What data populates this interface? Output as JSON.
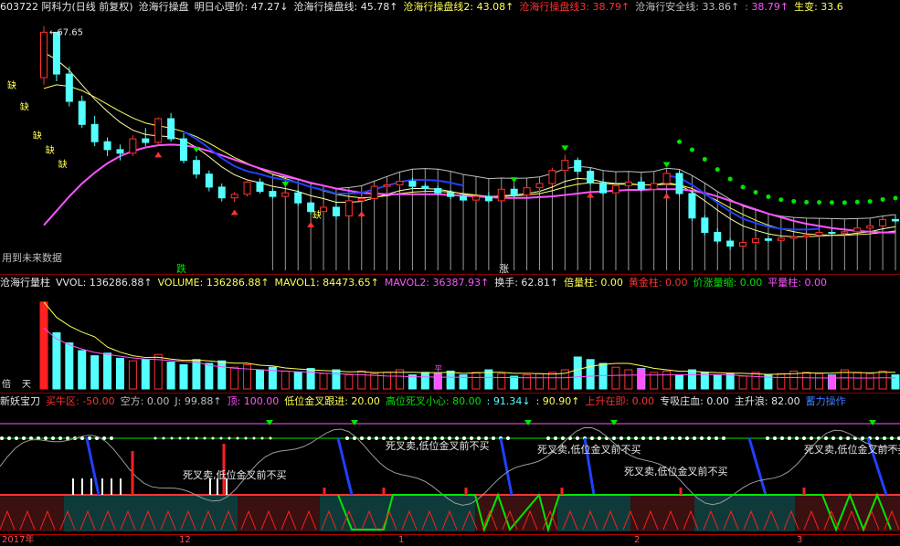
{
  "main_header": [
    {
      "text": "603722 阿科力(日线 前复权)",
      "color": "white"
    },
    {
      "text": "沧海行操盘",
      "color": "white"
    },
    {
      "text": "明日心理价: 47.27↓",
      "color": "white"
    },
    {
      "text": "沧海行操盘线: 45.78↑",
      "color": "white"
    },
    {
      "text": "沧海行操盘线2: 43.08↑",
      "color": "yellow"
    },
    {
      "text": "沧海行操盘线3: 38.79↑",
      "color": "red"
    },
    {
      "text": "沧海行安全线: 33.86↑",
      "color": "gray"
    },
    {
      "text": ": 38.79↑",
      "color": "magenta"
    },
    {
      "text": "生变: 33.6",
      "color": "yellow"
    }
  ],
  "price_high_label": "67.65",
  "watermark": "用到未来数据",
  "signal_die": "跌",
  "signal_zhang": "涨",
  "missing_tag": "缺",
  "volume_header": [
    {
      "text": "沧海行量柱",
      "color": "white"
    },
    {
      "text": "VVOL: 136286.88↑",
      "color": "white"
    },
    {
      "text": "VOLUME: 136286.88↑",
      "color": "yellow"
    },
    {
      "text": "MAVOL1: 84473.65↑",
      "color": "yellow"
    },
    {
      "text": "MAVOL2: 36387.93↑",
      "color": "magenta"
    },
    {
      "text": "换手: 62.81↑",
      "color": "white"
    },
    {
      "text": "倍量柱: 0.00",
      "color": "yellow"
    },
    {
      "text": "黄金柱: 0.00",
      "color": "red"
    },
    {
      "text": "价涨量缩: 0.00",
      "color": "green"
    },
    {
      "text": "平量柱: 0.00",
      "color": "magenta"
    }
  ],
  "volume_side_labels": [
    "倍",
    "天"
  ],
  "volume_mark": "平",
  "ind_header": [
    {
      "text": "新妖宝刀",
      "color": "white"
    },
    {
      "text": "买牛区: -50.00",
      "color": "red"
    },
    {
      "text": "空方: 0.00",
      "color": "gray"
    },
    {
      "text": "J: 99.88↑",
      "color": "gray"
    },
    {
      "text": "顶: 100.00",
      "color": "magenta"
    },
    {
      "text": "低位金叉跟进: 20.00",
      "color": "yellow"
    },
    {
      "text": "高位死叉小心: 80.00",
      "color": "green"
    },
    {
      "text": ": 91.34↓",
      "color": "cyan"
    },
    {
      "text": ": 90.90↑",
      "color": "yellow"
    },
    {
      "text": "上升在即: 0.00",
      "color": "red"
    },
    {
      "text": "专吸庄血: 0.00",
      "color": "white"
    },
    {
      "text": "主升浪: 82.00",
      "color": "white"
    },
    {
      "text": "蓄力操作",
      "color": "blue"
    }
  ],
  "annotation_text": "死叉卖,低位金叉前不买",
  "time_axis": [
    "2017年",
    "12",
    "1",
    "2",
    "3"
  ],
  "chart_data": {
    "type": "candlestick",
    "title": "603722 阿科力(日线 前复权)",
    "x_ticks": [
      "2017年",
      "12",
      "1",
      "2",
      "3"
    ],
    "price_extremes": {
      "high": 67.65
    },
    "candles": [
      [
        60.5,
        67.65,
        59.5,
        66.8
      ],
      [
        66.8,
        66.2,
        60.0,
        61.0
      ],
      [
        61.0,
        62.0,
        56.5,
        57.2
      ],
      [
        57.2,
        58.0,
        53.5,
        54.0
      ],
      [
        54.0,
        55.2,
        51.0,
        51.6
      ],
      [
        51.6,
        52.2,
        49.6,
        50.5
      ],
      [
        50.5,
        51.2,
        49.0,
        50.0
      ],
      [
        50.0,
        52.5,
        49.6,
        52.0
      ],
      [
        52.0,
        53.5,
        51.0,
        51.5
      ],
      [
        51.5,
        55.0,
        51.2,
        54.8
      ],
      [
        54.8,
        55.6,
        51.6,
        52.0
      ],
      [
        52.0,
        52.8,
        48.6,
        49.0
      ],
      [
        49.0,
        49.6,
        46.5,
        47.1
      ],
      [
        47.1,
        47.6,
        44.7,
        45.3
      ],
      [
        45.3,
        45.8,
        43.3,
        43.8
      ],
      [
        43.8,
        44.6,
        43.2,
        44.3
      ],
      [
        44.3,
        46.3,
        44.0,
        46.0
      ],
      [
        46.0,
        46.5,
        44.4,
        44.7
      ],
      [
        44.7,
        45.1,
        43.7,
        44.0
      ],
      [
        44.0,
        44.8,
        43.3,
        44.5
      ],
      [
        44.5,
        44.9,
        42.7,
        43.1
      ],
      [
        43.1,
        43.4,
        41.5,
        41.9
      ],
      [
        41.9,
        43.0,
        41.6,
        42.5
      ],
      [
        42.5,
        43.2,
        40.8,
        41.3
      ],
      [
        41.3,
        43.6,
        41.0,
        43.4
      ],
      [
        43.4,
        44.1,
        43.0,
        43.7
      ],
      [
        43.7,
        45.6,
        43.5,
        45.4
      ],
      [
        45.4,
        46.0,
        45.0,
        45.6
      ],
      [
        45.6,
        46.4,
        45.3,
        46.1
      ],
      [
        46.1,
        46.6,
        45.0,
        45.4
      ],
      [
        45.4,
        45.8,
        44.6,
        45.1
      ],
      [
        45.1,
        45.5,
        44.2,
        44.5
      ],
      [
        44.5,
        44.9,
        43.6,
        44.0
      ],
      [
        44.0,
        44.4,
        43.2,
        43.5
      ],
      [
        43.5,
        44.2,
        43.3,
        44.0
      ],
      [
        44.0,
        44.6,
        43.1,
        43.4
      ],
      [
        43.4,
        45.2,
        43.2,
        45.0
      ],
      [
        45.0,
        45.4,
        43.9,
        44.2
      ],
      [
        44.2,
        45.4,
        44.0,
        45.2
      ],
      [
        45.2,
        46.0,
        44.5,
        45.8
      ],
      [
        45.8,
        48.0,
        45.5,
        47.6
      ],
      [
        47.6,
        49.8,
        47.0,
        49.0
      ],
      [
        49.0,
        49.4,
        47.1,
        47.5
      ],
      [
        47.5,
        47.9,
        45.6,
        45.9
      ],
      [
        45.9,
        46.4,
        44.1,
        44.5
      ],
      [
        44.5,
        45.8,
        44.2,
        45.5
      ],
      [
        45.5,
        46.3,
        45.2,
        46.0
      ],
      [
        46.0,
        46.7,
        44.6,
        45.0
      ],
      [
        45.0,
        46.0,
        44.7,
        45.8
      ],
      [
        45.8,
        47.5,
        45.5,
        47.2
      ],
      [
        47.2,
        47.6,
        44.0,
        44.4
      ],
      [
        44.4,
        44.8,
        40.6,
        41.0
      ],
      [
        41.0,
        41.4,
        38.6,
        39.0
      ],
      [
        39.0,
        39.6,
        37.4,
        37.8
      ],
      [
        37.8,
        38.2,
        36.6,
        37.1
      ],
      [
        37.1,
        38.0,
        36.7,
        37.6
      ],
      [
        37.6,
        38.4,
        37.3,
        38.1
      ],
      [
        38.1,
        38.5,
        37.6,
        37.9
      ],
      [
        37.9,
        38.4,
        37.7,
        38.2
      ],
      [
        38.2,
        38.6,
        37.9,
        38.4
      ],
      [
        38.4,
        38.8,
        38.0,
        38.6
      ],
      [
        38.6,
        39.2,
        38.3,
        39.0
      ],
      [
        39.0,
        39.4,
        38.6,
        38.9
      ],
      [
        38.9,
        39.3,
        38.5,
        39.1
      ],
      [
        39.1,
        39.8,
        38.9,
        39.6
      ],
      [
        39.6,
        40.2,
        39.3,
        39.9
      ],
      [
        39.9,
        41.0,
        39.7,
        40.8
      ],
      [
        40.8,
        41.4,
        40.3,
        40.6
      ]
    ],
    "series": [
      {
        "name": "沧海行操盘线",
        "values": [
          64,
          63,
          61.5,
          59.5,
          57.5,
          55.8,
          54.3,
          53.2,
          52.6,
          52.4,
          52.3,
          51.8,
          50.8,
          49.5,
          48.1,
          47.0,
          46.3,
          45.9,
          45.4,
          45.1,
          44.7,
          44.1,
          43.7,
          43.2,
          43.2,
          43.3,
          43.8,
          44.3,
          44.8,
          45.1,
          45.1,
          45.0,
          44.7,
          44.3,
          44.1,
          43.9,
          44.1,
          44.2,
          44.4,
          44.7,
          45.3,
          46.1,
          46.5,
          46.4,
          46.0,
          45.8,
          45.8,
          45.6,
          45.6,
          45.9,
          45.6,
          44.6,
          43.4,
          42.1,
          40.9,
          39.9,
          39.3,
          38.8,
          38.5,
          38.4,
          38.4,
          38.5,
          38.6,
          38.7,
          38.9,
          39.1,
          39.5,
          39.8
        ],
        "color": "#ffffaa"
      },
      {
        "name": "沧海行操盘线2",
        "values": [
          59,
          59.5,
          59.3,
          58.7,
          57.8,
          56.8,
          55.8,
          54.9,
          54.2,
          53.8,
          53.5,
          53.0,
          52.3,
          51.4,
          50.4,
          49.4,
          48.6,
          47.8,
          47.1,
          46.5,
          45.9,
          45.3,
          44.8,
          44.3,
          44.0,
          43.8,
          43.9,
          44.1,
          44.4,
          44.6,
          44.7,
          44.7,
          44.6,
          44.4,
          44.2,
          44.0,
          44.0,
          44.1,
          44.2,
          44.4,
          44.8,
          45.3,
          45.7,
          45.9,
          45.8,
          45.7,
          45.7,
          45.6,
          45.6,
          45.7,
          45.6,
          45.1,
          44.3,
          43.4,
          42.4,
          41.5,
          40.7,
          40.0,
          39.5,
          39.1,
          38.8,
          38.7,
          38.6,
          38.6,
          38.7,
          38.8,
          39.0,
          39.2
        ],
        "color": "#ffff54"
      },
      {
        "name": "沧海行操盘线3",
        "values": [
          40,
          42,
          44,
          45.8,
          47.3,
          48.6,
          49.6,
          50.3,
          50.8,
          51.1,
          51.2,
          51.1,
          50.8,
          50.3,
          49.7,
          49.1,
          48.5,
          47.9,
          47.4,
          46.9,
          46.4,
          45.9,
          45.5,
          45.1,
          44.8,
          44.5,
          44.4,
          44.3,
          44.3,
          44.3,
          44.3,
          44.3,
          44.2,
          44.1,
          44.0,
          43.9,
          43.8,
          43.8,
          43.8,
          43.9,
          44.0,
          44.2,
          44.4,
          44.6,
          44.7,
          44.8,
          44.9,
          44.9,
          45.0,
          45.0,
          45.0,
          44.8,
          44.5,
          44.0,
          43.4,
          42.8,
          42.2,
          41.6,
          41.1,
          40.6,
          40.2,
          39.9,
          39.6,
          39.4,
          39.2,
          39.1,
          39.0,
          39.0
        ],
        "color": "#ff54ff"
      }
    ],
    "volume": {
      "series": [
        "VOLUME",
        "MAVOL1",
        "MAVOL2"
      ],
      "values": [
        136,
        88,
        72,
        60,
        52,
        56,
        48,
        44,
        46,
        54,
        42,
        38,
        46,
        40,
        44,
        34,
        38,
        30,
        34,
        28,
        26,
        32,
        24,
        30,
        22,
        28,
        24,
        26,
        30,
        22,
        26,
        24,
        28,
        22,
        26,
        30,
        24,
        20,
        22,
        24,
        26,
        30,
        50,
        46,
        40,
        34,
        30,
        32,
        26,
        28,
        22,
        30,
        26,
        22,
        24,
        20,
        26,
        22,
        24,
        28,
        26,
        24,
        22,
        30,
        26,
        24,
        28,
        22
      ]
    },
    "indicator": {
      "name": "新妖宝刀",
      "levels": {
        "顶": 100,
        "高位死叉小心": 80,
        "低位金叉跟进": 20,
        "买牛区": -50
      },
      "J": 99.88
    }
  }
}
